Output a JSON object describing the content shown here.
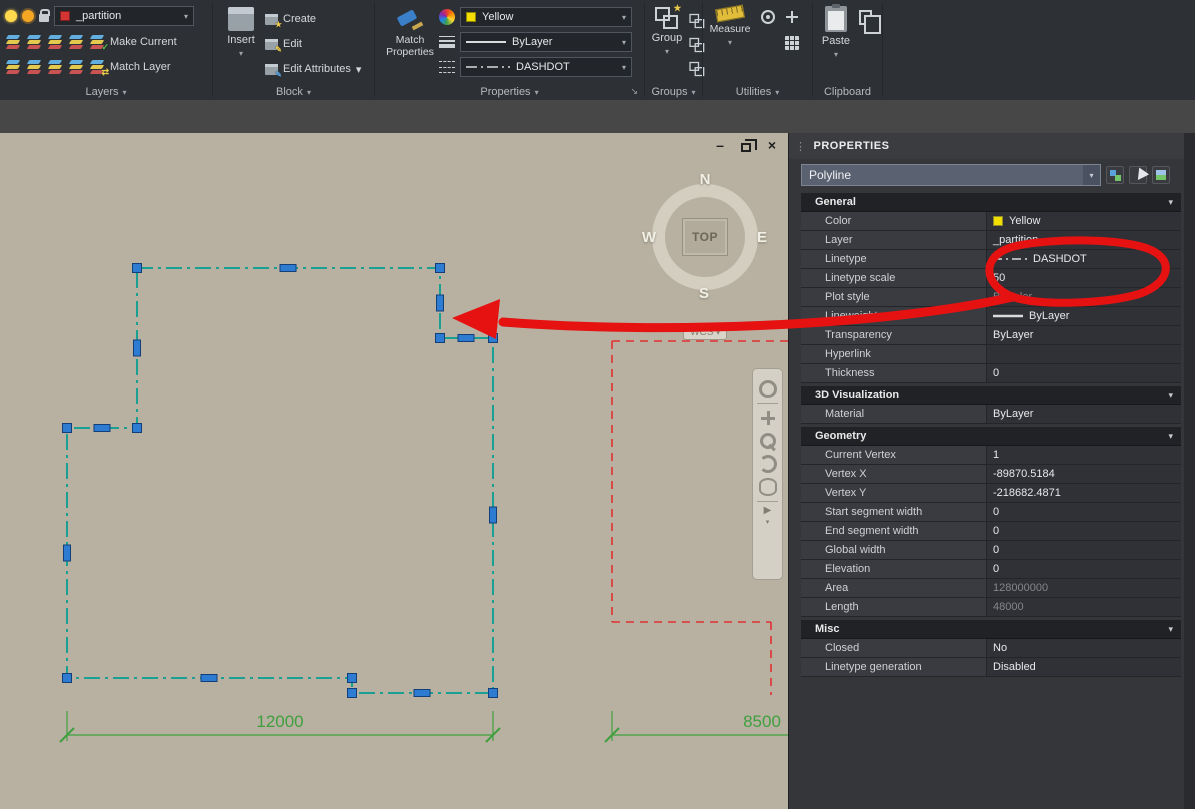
{
  "icons": {
    "chevron_down": "▾",
    "close": "×",
    "minimize": "–",
    "check": "✓",
    "swap": "⇄",
    "star": "★",
    "pencil": "✎",
    "play": "▶",
    "dots": "⋮",
    "launcher": "↘"
  },
  "ribbon": {
    "layers": {
      "layer_value": "_partition",
      "make_current": "Make Current",
      "match_layer": "Match Layer",
      "panel": "Layers"
    },
    "block": {
      "insert": "Insert",
      "create": "Create",
      "edit": "Edit",
      "edit_attributes": "Edit Attributes",
      "panel": "Block"
    },
    "props": {
      "match_properties": "Match Properties",
      "color_value": "Yellow",
      "lineweight_value": "ByLayer",
      "linetype_value": "DASHDOT",
      "panel": "Properties"
    },
    "groups": {
      "group": "Group",
      "panel": "Groups"
    },
    "utilities": {
      "measure": "Measure",
      "panel": "Utilities"
    },
    "clipboard": {
      "paste": "Paste",
      "panel": "Clipboard"
    }
  },
  "canvas": {
    "compass": {
      "n": "N",
      "w": "W",
      "e": "E",
      "s": "S",
      "top": "TOP"
    },
    "wcs": "WCS",
    "dims": [
      "12000",
      "8500"
    ]
  },
  "palette": {
    "title": "PROPERTIES",
    "selector": "Polyline",
    "sections": [
      {
        "title": "General",
        "rows": [
          {
            "label": "Color",
            "value": "Yellow"
          },
          {
            "label": "Layer",
            "value": "_partition"
          },
          {
            "label": "Linetype",
            "value": "DASHDOT"
          },
          {
            "label": "Linetype scale",
            "value": "50"
          },
          {
            "label": "Plot style",
            "value": "ByColor"
          },
          {
            "label": "Lineweight",
            "value": "ByLayer"
          },
          {
            "label": "Transparency",
            "value": "ByLayer"
          },
          {
            "label": "Hyperlink",
            "value": ""
          },
          {
            "label": "Thickness",
            "value": "0"
          }
        ]
      },
      {
        "title": "3D Visualization",
        "rows": [
          {
            "label": "Material",
            "value": "ByLayer"
          }
        ]
      },
      {
        "title": "Geometry",
        "rows": [
          {
            "label": "Current Vertex",
            "value": "1"
          },
          {
            "label": "Vertex X",
            "value": "-89870.5184"
          },
          {
            "label": "Vertex Y",
            "value": "-218682.4871"
          },
          {
            "label": "Start segment width",
            "value": "0"
          },
          {
            "label": "End segment width",
            "value": "0"
          },
          {
            "label": "Global width",
            "value": "0"
          },
          {
            "label": "Elevation",
            "value": "0"
          },
          {
            "label": "Area",
            "value": "128000000"
          },
          {
            "label": "Length",
            "value": "48000"
          }
        ]
      },
      {
        "title": "Misc",
        "rows": [
          {
            "label": "Closed",
            "value": "No"
          },
          {
            "label": "Linetype generation",
            "value": "Disabled"
          }
        ]
      }
    ]
  },
  "colors": {
    "canvas_bg": "#b8b1a1",
    "polyline": "#1aa093",
    "grip": "#2e7bd2",
    "annotation": "#e61212",
    "dimension": "#3f9f3f",
    "layer_swatch": "#d63535",
    "yellow": "#f2df00",
    "red_dashed": "#e03030"
  }
}
